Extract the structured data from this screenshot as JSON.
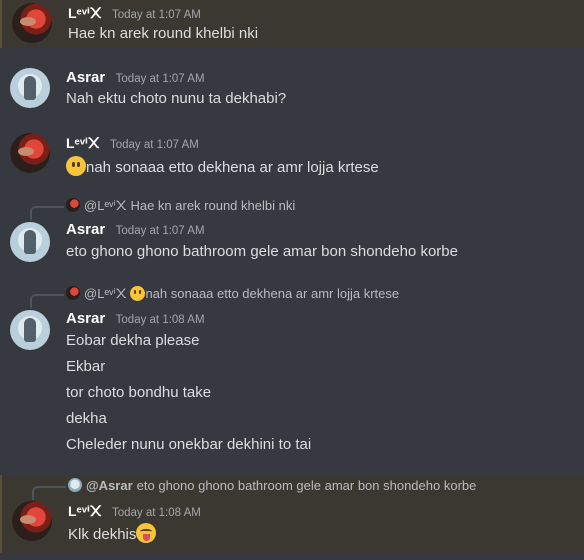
{
  "messages": [
    {
      "author": "Lᵉᵛⁱ᙭",
      "time": "Today at 1:07 AM",
      "lines": [
        "Hae kn arek round khelbi nki"
      ]
    },
    {
      "author": "Asrar",
      "time": "Today at 1:07 AM",
      "lines": [
        "Nah ektu choto nunu ta dekhabi?"
      ]
    },
    {
      "author": "Lᵉᵛⁱ᙭",
      "time": "Today at 1:07 AM",
      "lines": [
        "nah sonaaa etto dekhena ar amr lojja krtese"
      ]
    },
    {
      "author": "Asrar",
      "time": "Today at 1:07 AM",
      "reply": {
        "author": "@Lᵉᵛⁱ᙭",
        "text": "Hae kn arek round khelbi nki"
      },
      "lines": [
        "eto ghono ghono bathroom gele amar bon shondeho korbe"
      ]
    },
    {
      "author": "Asrar",
      "time": "Today at 1:08 AM",
      "reply": {
        "author": "@Lᵉᵛⁱ᙭",
        "text": "nah sonaaa etto dekhena ar amr lojja krtese"
      },
      "lines": [
        "Eobar dekha please",
        "Ekbar",
        "tor choto bondhu take",
        "dekha",
        "Cheleder nunu onekbar dekhini to tai"
      ]
    },
    {
      "author": "Lᵉᵛⁱ᙭",
      "time": "Today at 1:08 AM",
      "reply": {
        "author": "@Asrar",
        "text": "eto ghono ghono bathroom gele amar bon shondeho korbe"
      },
      "lines": [
        "Klk dekhis"
      ]
    }
  ]
}
